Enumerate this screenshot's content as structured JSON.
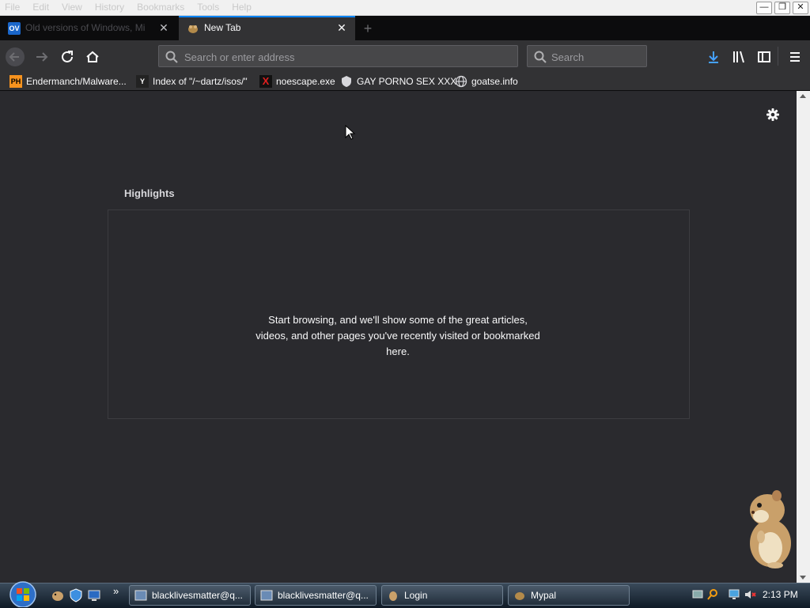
{
  "menu": [
    "File",
    "Edit",
    "View",
    "History",
    "Bookmarks",
    "Tools",
    "Help"
  ],
  "tabs": [
    {
      "title": "Old versions of Windows, Mi",
      "favicon": "OV",
      "active": false
    },
    {
      "title": "New Tab",
      "favicon": "hamster",
      "active": true
    }
  ],
  "navbar": {
    "url_placeholder": "Search or enter address",
    "search_placeholder": "Search"
  },
  "bookmarks": [
    {
      "label": "Endermanch/Malware...",
      "icon": "PH"
    },
    {
      "label": "Index of \"/~dartz/isos/\"",
      "icon": "Y"
    },
    {
      "label": "noescape.exe",
      "icon": "X"
    },
    {
      "label": "GAY PORNO SEX XXX",
      "icon": "shield"
    },
    {
      "label": "goatse.info",
      "icon": "globe"
    }
  ],
  "content": {
    "highlights_title": "Highlights",
    "empty_message": "Start browsing, and we'll show some of the great articles, videos, and other pages you've recently visited or bookmarked here."
  },
  "taskbar": {
    "items": [
      {
        "label": "blacklivesmatter@q..."
      },
      {
        "label": "blacklivesmatter@q..."
      },
      {
        "label": "Login"
      },
      {
        "label": "Mypal"
      }
    ],
    "clock": "2:13 PM",
    "quicklaunch_more": "»"
  },
  "colors": {
    "accent": "#0a84ff",
    "background": "#2a2a2e",
    "toolbar": "#323234"
  }
}
